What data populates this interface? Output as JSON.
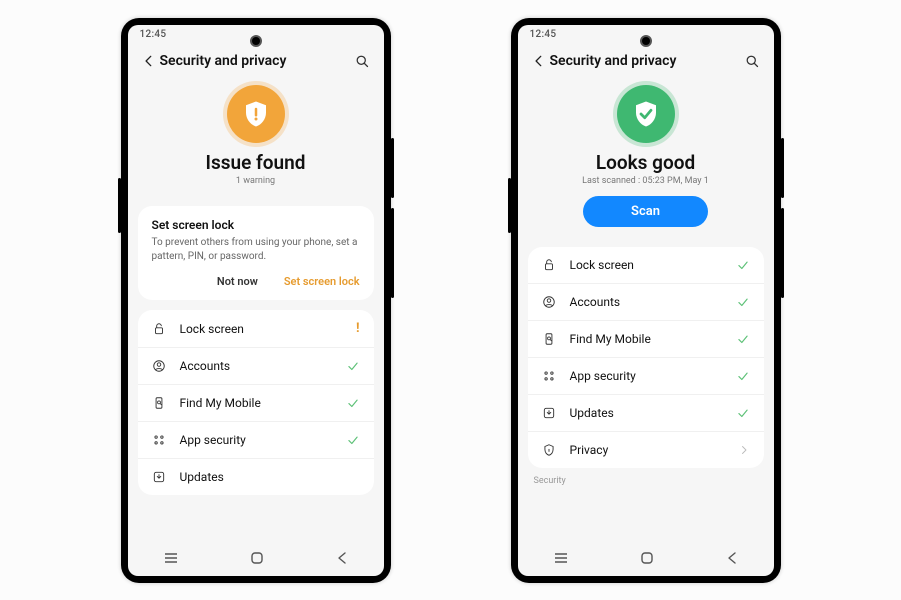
{
  "status_time": "12:45",
  "header": {
    "title": "Security and privacy"
  },
  "phone_left": {
    "hero_title": "Issue found",
    "hero_sub": "1 warning",
    "card": {
      "title": "Set screen lock",
      "sub": "To prevent others from using your phone, set a pattern, PIN, or password.",
      "secondary": "Not now",
      "primary": "Set screen lock"
    },
    "items": [
      {
        "icon": "lock",
        "label": "Lock screen",
        "trail": "warn"
      },
      {
        "icon": "account",
        "label": "Accounts",
        "trail": "ok"
      },
      {
        "icon": "find",
        "label": "Find My Mobile",
        "trail": "ok"
      },
      {
        "icon": "apps",
        "label": "App security",
        "trail": "ok"
      },
      {
        "icon": "update",
        "label": "Updates",
        "trail": ""
      }
    ]
  },
  "phone_right": {
    "hero_title": "Looks good",
    "hero_sub": "Last scanned : 05:23 PM, May 1",
    "scan": "Scan",
    "items": [
      {
        "icon": "lock",
        "label": "Lock screen",
        "trail": "ok"
      },
      {
        "icon": "account",
        "label": "Accounts",
        "trail": "ok"
      },
      {
        "icon": "find",
        "label": "Find My Mobile",
        "trail": "ok"
      },
      {
        "icon": "apps",
        "label": "App security",
        "trail": "ok"
      },
      {
        "icon": "update",
        "label": "Updates",
        "trail": "ok"
      },
      {
        "icon": "privacy",
        "label": "Privacy",
        "trail": "chev"
      }
    ],
    "footer_label": "Security"
  }
}
